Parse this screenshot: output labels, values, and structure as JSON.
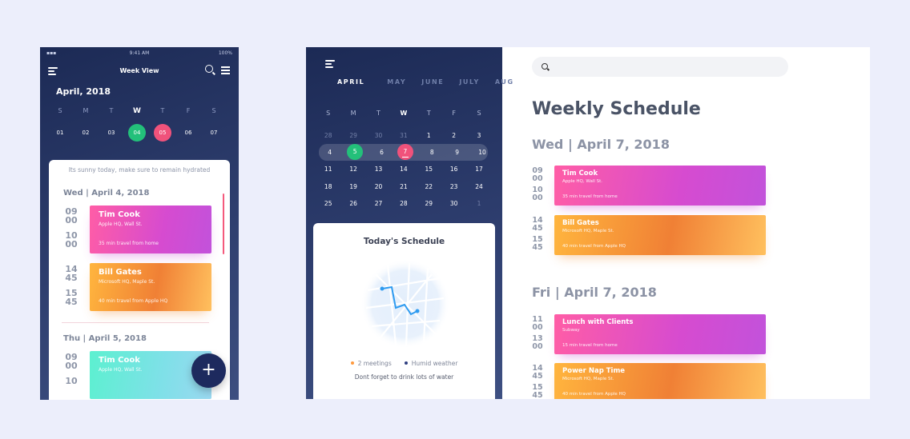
{
  "phone": {
    "status": {
      "time": "9:41 AM",
      "battery": "100%"
    },
    "title": "Week View",
    "month": "April, 2018",
    "weekdays": [
      "S",
      "M",
      "T",
      "W",
      "T",
      "F",
      "S"
    ],
    "days": [
      "01",
      "02",
      "03",
      "04",
      "05",
      "06",
      "07"
    ],
    "tip": "Its sunny today, make sure to remain hydrated",
    "day1": {
      "date": "Wed | April 4, 2018",
      "events": [
        {
          "start_h": "09",
          "start_m": "00",
          "end_h": "10",
          "end_m": "00",
          "name": "Tim Cook",
          "location": "Apple HQ, Wall St.",
          "travel": "35 min travel from home"
        },
        {
          "start_h": "14",
          "start_m": "45",
          "end_h": "15",
          "end_m": "45",
          "name": "Bill Gates",
          "location": "Microsoft HQ, Maple St.",
          "travel": "40 min travel from Apple HQ"
        }
      ]
    },
    "day2": {
      "date": "Thu | April 5, 2018",
      "events": [
        {
          "start_h": "09",
          "start_m": "00",
          "end_h": "10",
          "name": "Tim Cook",
          "location": "Apple HQ, Wall St."
        }
      ]
    },
    "fab_label": "+"
  },
  "tablet": {
    "months": [
      "APRIL",
      "MAY",
      "JUNE",
      "JULY",
      "AUG"
    ],
    "weekdays": [
      "S",
      "M",
      "T",
      "W",
      "T",
      "F",
      "S"
    ],
    "weeks": [
      [
        "28",
        "29",
        "30",
        "31",
        "1",
        "2",
        "3"
      ],
      [
        "4",
        "5",
        "6",
        "7",
        "8",
        "9",
        "10"
      ],
      [
        "11",
        "12",
        "13",
        "14",
        "15",
        "16",
        "17"
      ],
      [
        "18",
        "19",
        "20",
        "21",
        "22",
        "23",
        "24"
      ],
      [
        "25",
        "26",
        "27",
        "28",
        "29",
        "30",
        "1"
      ]
    ],
    "today": {
      "title": "Today's Schedule",
      "meetings": "2 meetings",
      "weather": "Humid weather",
      "note": "Dont forget to drink lots of water"
    },
    "heading": "Weekly Schedule",
    "day1": {
      "date": "Wed | April 7, 2018",
      "events": [
        {
          "start_h": "09",
          "start_m": "00",
          "end_h": "10",
          "end_m": "00",
          "name": "Tim Cook",
          "location": "Apple HQ, Wall St.",
          "travel": "35 min travel from home"
        },
        {
          "start_h": "14",
          "start_m": "45",
          "end_h": "15",
          "end_m": "45",
          "name": "Bill Gates",
          "location": "Microsoft HQ, Maple St.",
          "travel": "40 min travel from Apple HQ"
        }
      ]
    },
    "day2": {
      "date": "Fri | April 7, 2018",
      "events": [
        {
          "start_h": "11",
          "start_m": "00",
          "end_h": "13",
          "end_m": "00",
          "name": "Lunch with Clients",
          "location": "Subway",
          "travel": "15 min travel from home"
        },
        {
          "start_h": "14",
          "start_m": "45",
          "end_h": "15",
          "end_m": "45",
          "name": "Power Nap Time",
          "location": "Microsoft HQ, Maple St.",
          "travel": "40 min travel from Apple HQ"
        }
      ]
    }
  },
  "colors": {
    "navy": "#1c2a55",
    "green": "#23c07a",
    "pink": "#f0527b",
    "event_pink": "#d64bd0",
    "event_orange": "#f08035",
    "event_teal": "#5cf0d0"
  }
}
